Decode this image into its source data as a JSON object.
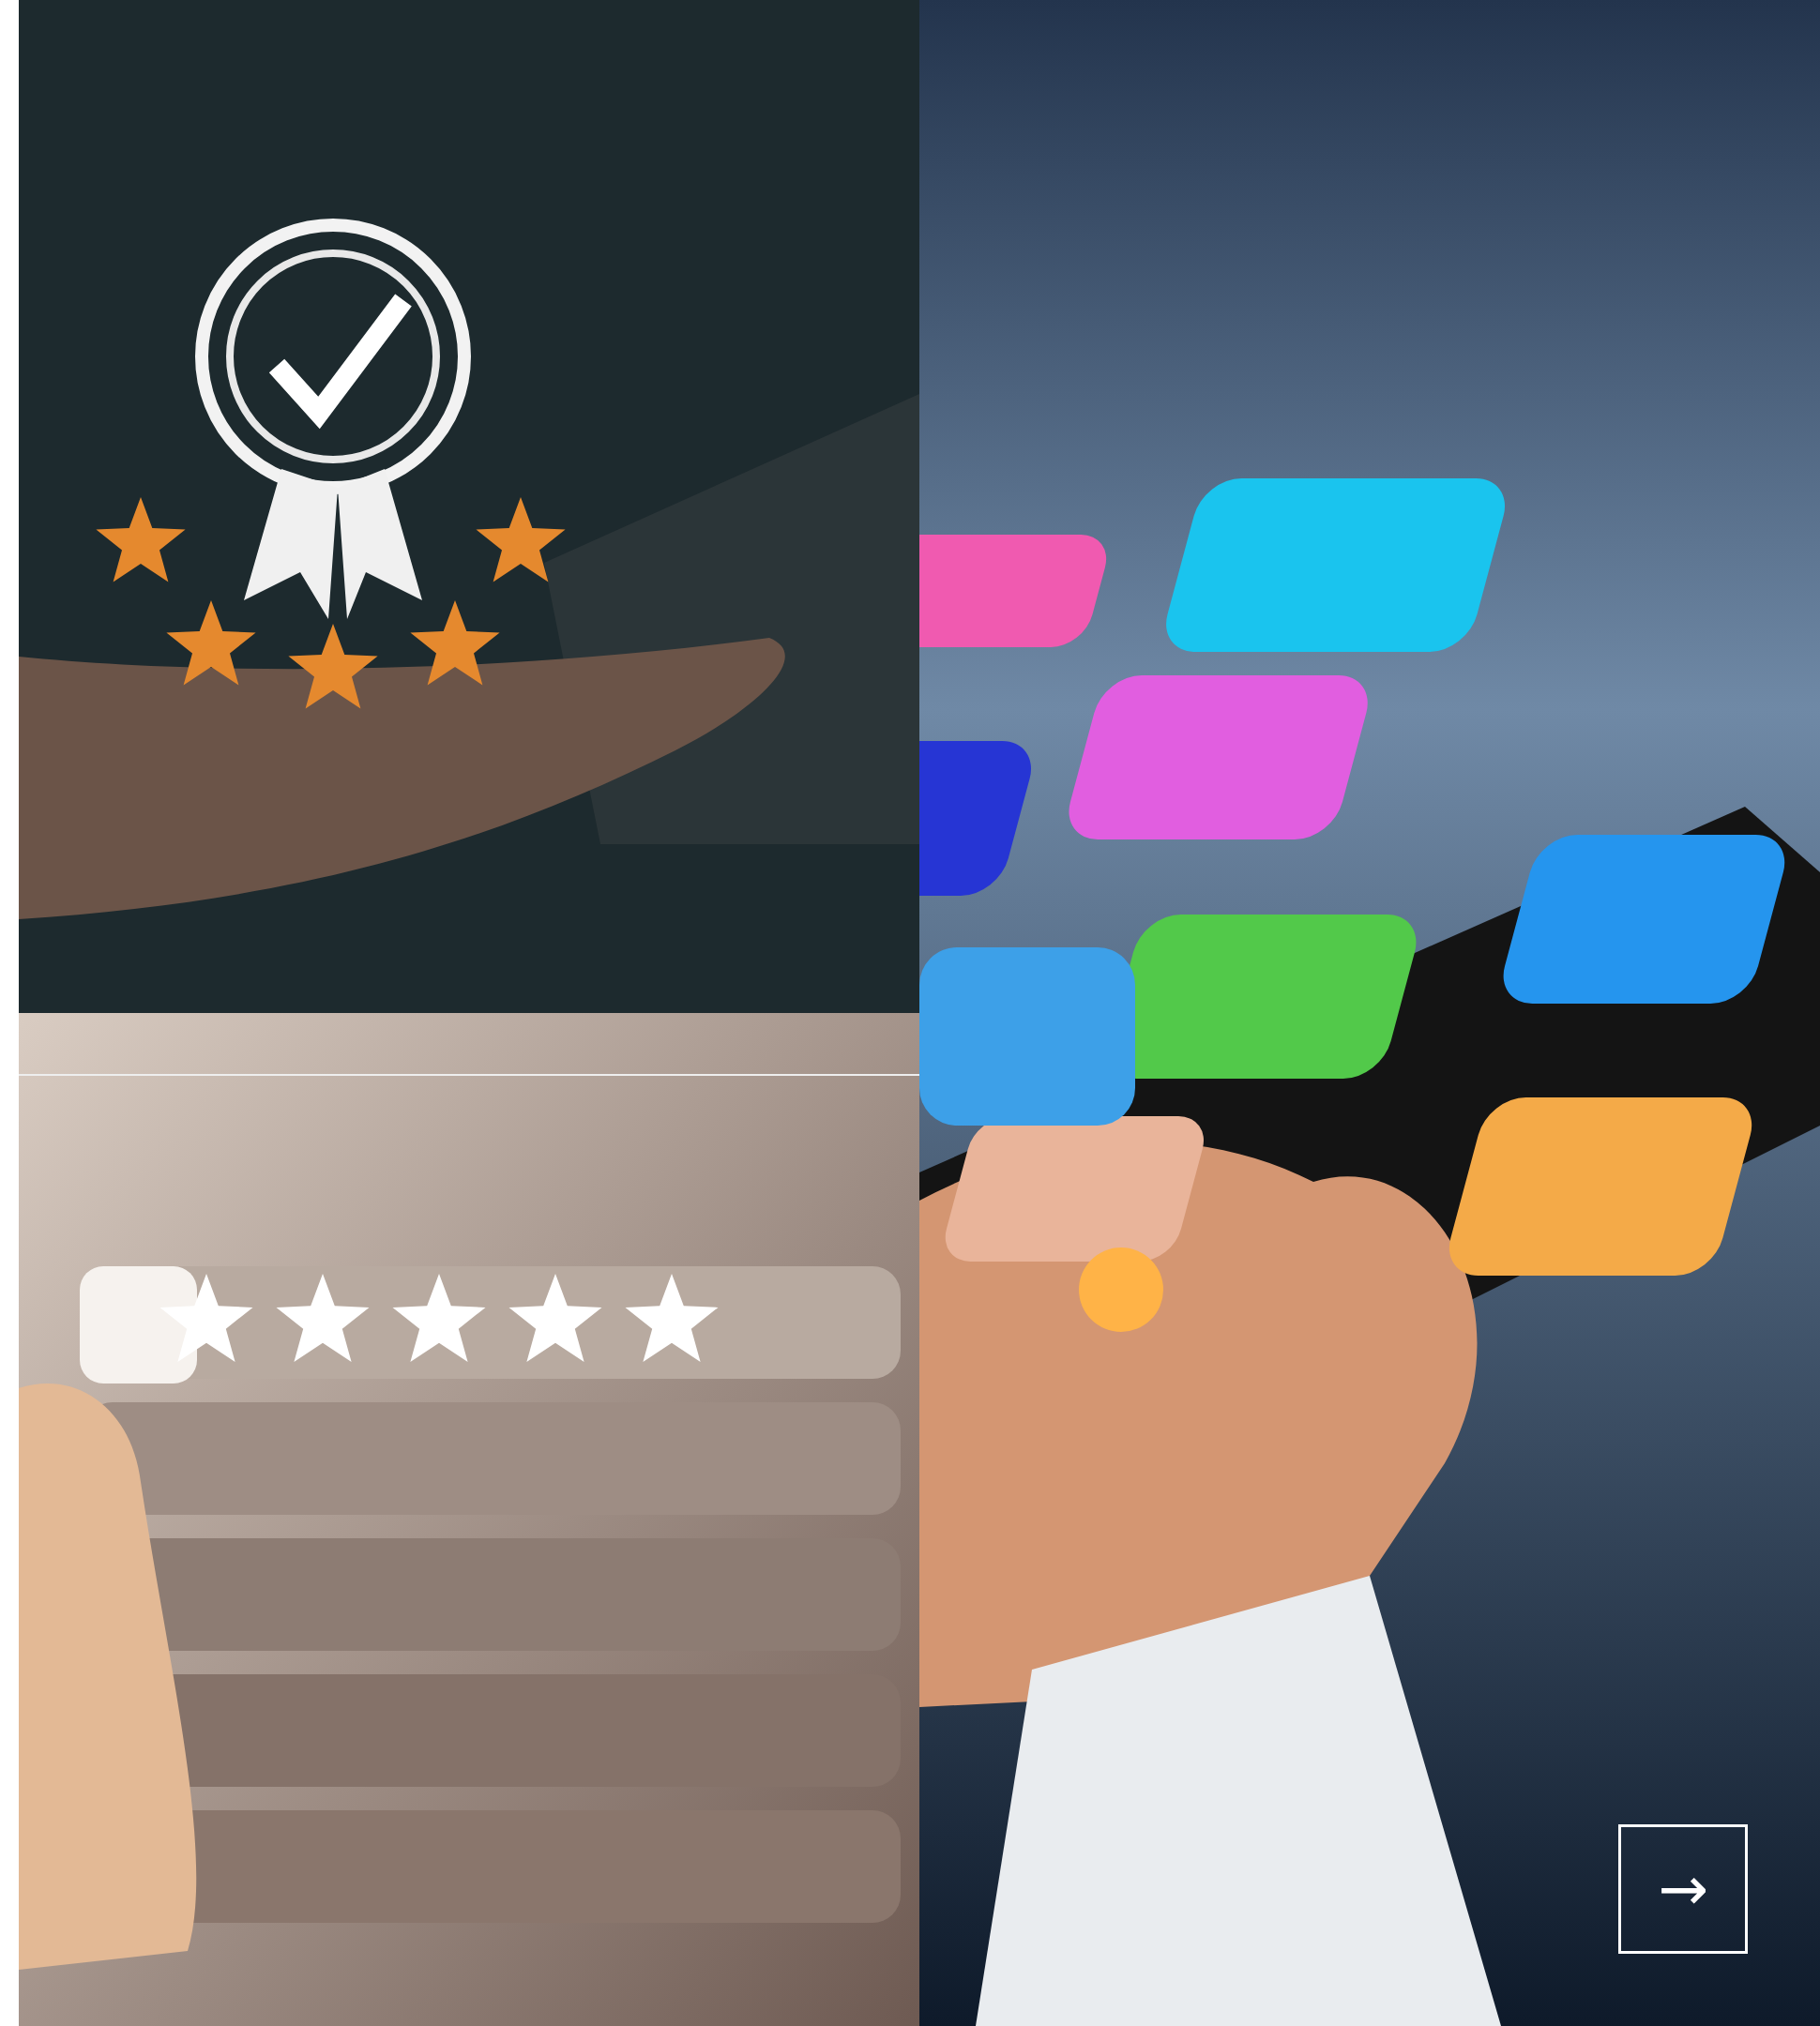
{
  "next_button": {
    "label": "→"
  }
}
